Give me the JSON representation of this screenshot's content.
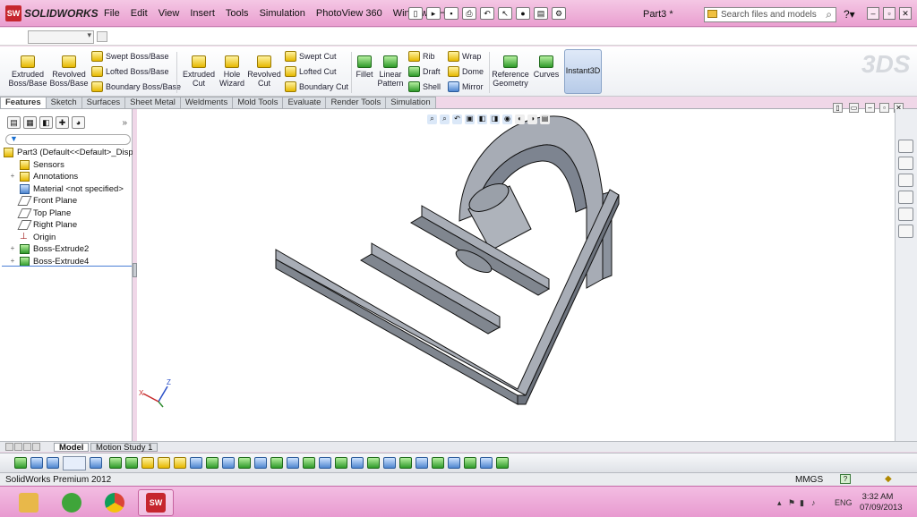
{
  "app": {
    "logo_text": "SOLIDWORKS",
    "document_title": "Part3 *",
    "search_placeholder": "Search files and models"
  },
  "menu": [
    "File",
    "Edit",
    "View",
    "Insert",
    "Tools",
    "Simulation",
    "PhotoView 360",
    "Window",
    "Help"
  ],
  "command_manager": {
    "extruded_boss": "Extruded Boss/Base",
    "revolved_boss": "Revolved Boss/Base",
    "swept_boss": "Swept Boss/Base",
    "lofted_boss": "Lofted Boss/Base",
    "boundary_boss": "Boundary Boss/Base",
    "extruded_cut": "Extruded Cut",
    "hole_wizard": "Hole Wizard",
    "revolved_cut": "Revolved Cut",
    "swept_cut": "Swept Cut",
    "lofted_cut": "Lofted Cut",
    "boundary_cut": "Boundary Cut",
    "fillet": "Fillet",
    "linear_pattern": "Linear Pattern",
    "rib": "Rib",
    "draft": "Draft",
    "shell": "Shell",
    "wrap": "Wrap",
    "dome": "Dome",
    "mirror": "Mirror",
    "reference_geometry": "Reference Geometry",
    "curves": "Curves",
    "instant3d": "Instant3D"
  },
  "tabs": [
    "Features",
    "Sketch",
    "Surfaces",
    "Sheet Metal",
    "Weldments",
    "Mold Tools",
    "Evaluate",
    "Render Tools",
    "Simulation"
  ],
  "feature_tree": [
    {
      "label": "Part3  (Default<<Default>_Disp",
      "icon": "part-icon",
      "expand": ""
    },
    {
      "label": "Sensors",
      "icon": "sensors-icon",
      "expand": ""
    },
    {
      "label": "Annotations",
      "icon": "annotations-icon",
      "expand": "+"
    },
    {
      "label": "Material <not specified>",
      "icon": "material-icon",
      "expand": ""
    },
    {
      "label": "Front Plane",
      "icon": "plane-icon",
      "expand": ""
    },
    {
      "label": "Top Plane",
      "icon": "plane-icon",
      "expand": ""
    },
    {
      "label": "Right Plane",
      "icon": "plane-icon",
      "expand": ""
    },
    {
      "label": "Origin",
      "icon": "origin-icon",
      "expand": ""
    },
    {
      "label": "Boss-Extrude2",
      "icon": "extrude-icon",
      "expand": "+"
    },
    {
      "label": "Boss-Extrude4",
      "icon": "extrude-icon",
      "expand": "+"
    }
  ],
  "bottom_tabs": {
    "model": "Model",
    "motion": "Motion Study 1"
  },
  "status": {
    "product": "SolidWorks Premium 2012",
    "units": "MMGS"
  },
  "taskbar": {
    "lang": "ENG",
    "time": "3:32 AM",
    "date": "07/09/2013"
  },
  "triad": {
    "x": "X",
    "z": "Z"
  },
  "colors": {
    "brand": "#c6262e",
    "frame": "#ea9fd0",
    "model_top": "#a8adb6",
    "model_side": "#7e8591"
  }
}
